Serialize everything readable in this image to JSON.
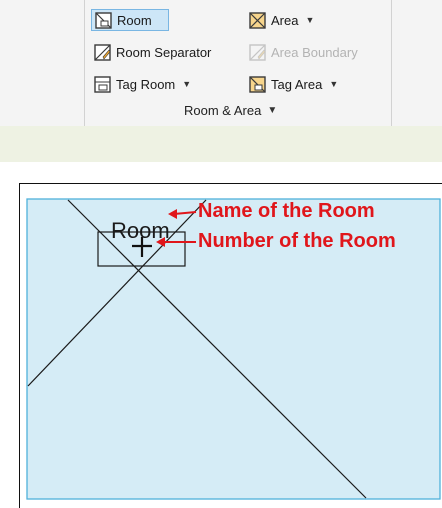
{
  "ribbon": {
    "room": "Room",
    "area": "Area",
    "room_separator": "Room Separator",
    "area_boundary": "Area Boundary",
    "tag_room": "Tag Room",
    "tag_area": "Tag Area",
    "panel_title": "Room & Area"
  },
  "plan": {
    "room_name": "Room",
    "annotation_name": "Name of the Room",
    "annotation_number": "Number of the Room"
  },
  "colors": {
    "room_fill": "#d5ecf6",
    "room_border": "#4fb1da",
    "annotation": "#e0161b",
    "selected_bg": "#cde6f7"
  }
}
